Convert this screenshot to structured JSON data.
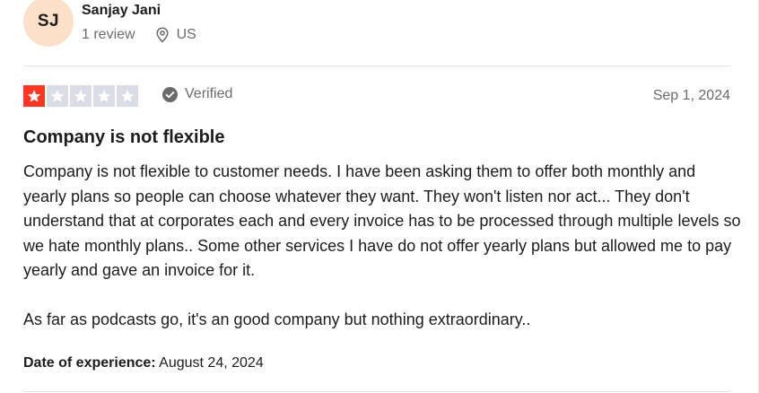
{
  "consumer": {
    "initials": "SJ",
    "name": "Sanjay Jani",
    "review_count": "1 review",
    "country": "US"
  },
  "review": {
    "rating": 1,
    "max_rating": 5,
    "verified_label": "Verified",
    "date": "Sep 1, 2024",
    "title": "Company is not flexible",
    "body": [
      "Company is not flexible to customer needs. I have been asking them to offer both monthly and yearly plans so people can choose whatever they want. They won't listen nor act... They don't understand that at corporates each and every invoice has to be processed through multiple levels so we hate monthly plans.. Some other services I have do not offer yearly plans but allowed me to pay yearly and gave an invoice for it.",
      "As far as podcasts go, it's an good company but nothing extraordinary.."
    ],
    "experience_label": "Date of experience:",
    "experience_date": "August 24, 2024"
  },
  "icons": {
    "location": "location-pin-icon",
    "verified": "verified-check-icon",
    "star": "star-icon"
  },
  "colors": {
    "avatar_bg": "#fde0c8",
    "star_filled_1": "#ff3722",
    "star_empty": "#dcdce6",
    "muted_text": "#6b6b6b",
    "text": "#1c1c1c"
  }
}
